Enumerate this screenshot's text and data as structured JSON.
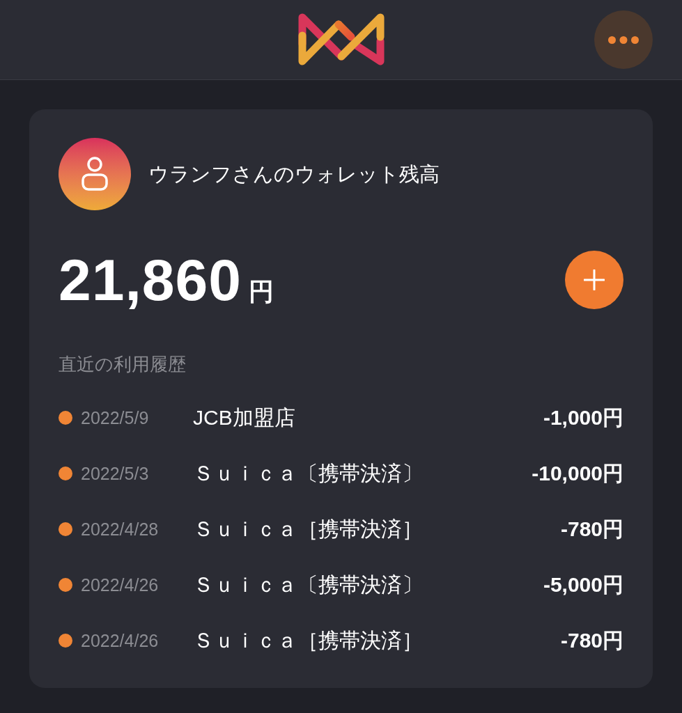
{
  "wallet": {
    "title": "ウランフさんのウォレット残高",
    "balance": "21,860",
    "currency": "円"
  },
  "history": {
    "heading": "直近の利用履歴",
    "rows": [
      {
        "date": "2022/5/9",
        "merchant": "JCB加盟店",
        "amount": "-1,000円"
      },
      {
        "date": "2022/5/3",
        "merchant": "Ｓｕｉｃａ〔携帯決済〕",
        "amount": "-10,000円"
      },
      {
        "date": "2022/4/28",
        "merchant": "Ｓｕｉｃａ［携帯決済］",
        "amount": "-780円"
      },
      {
        "date": "2022/4/26",
        "merchant": "Ｓｕｉｃａ〔携帯決済〕",
        "amount": "-5,000円"
      },
      {
        "date": "2022/4/26",
        "merchant": "Ｓｕｉｃａ［携帯決済］",
        "amount": "-780円"
      }
    ]
  }
}
